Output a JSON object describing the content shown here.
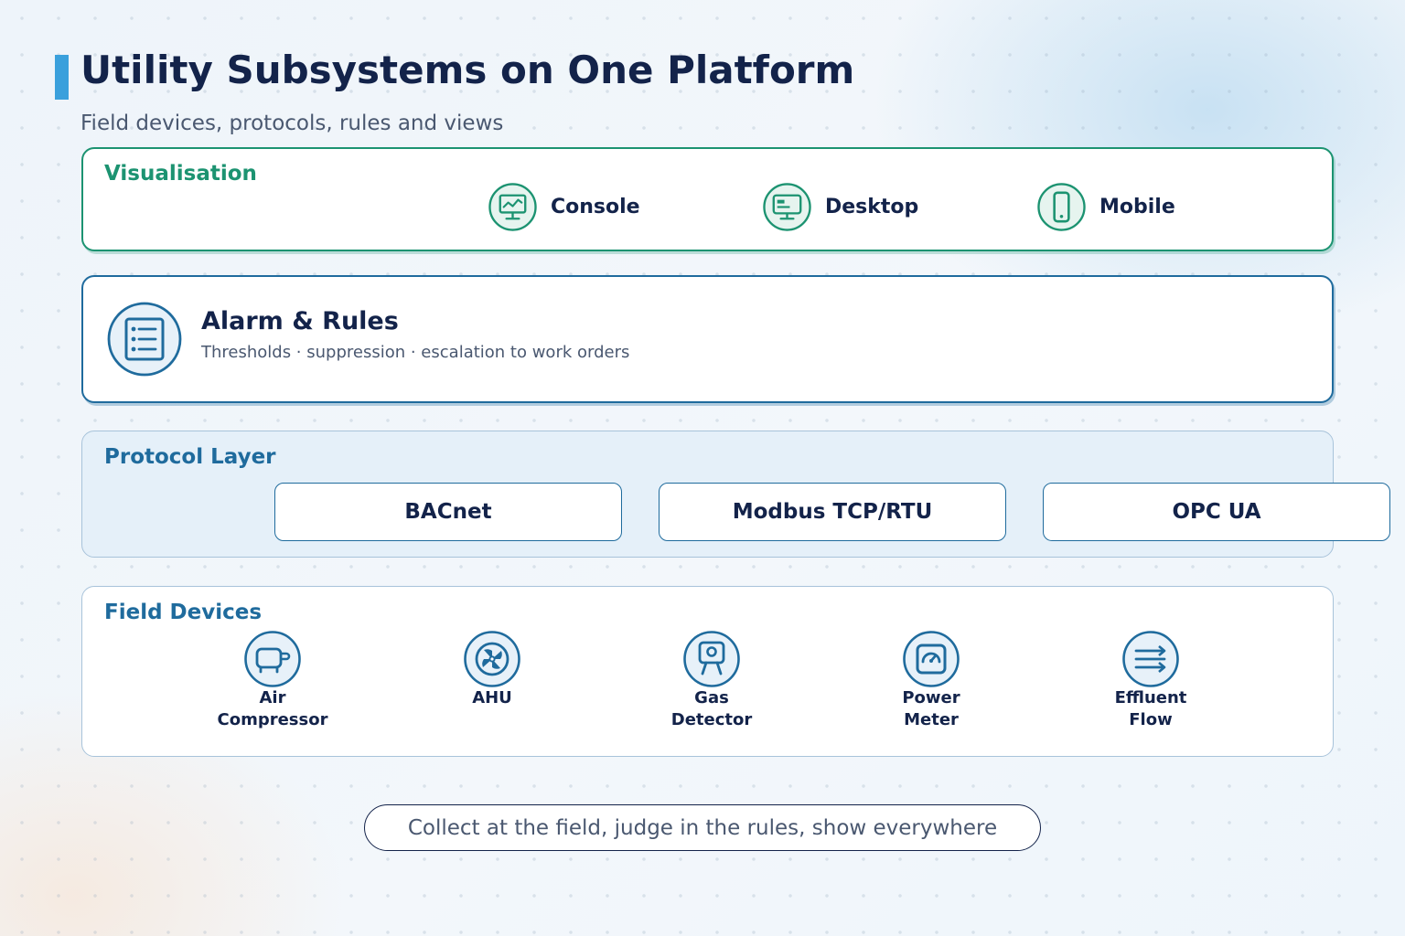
{
  "header": {
    "title": "Utility Subsystems on One Platform",
    "subtitle": "Field devices, protocols, rules and views"
  },
  "visualisation": {
    "label": "Visualisation",
    "items": [
      {
        "label": "Console",
        "icon": "console-monitor-icon"
      },
      {
        "label": "Desktop",
        "icon": "desktop-icon"
      },
      {
        "label": "Mobile",
        "icon": "mobile-phone-icon"
      }
    ]
  },
  "alarm": {
    "title": "Alarm & Rules",
    "description": "Thresholds · suppression · escalation to work orders",
    "icon": "checklist-icon"
  },
  "protocol": {
    "label": "Protocol Layer",
    "items": [
      "BACnet",
      "Modbus TCP/RTU",
      "OPC UA"
    ]
  },
  "field": {
    "label": "Field Devices",
    "devices": [
      {
        "line1": "Air",
        "line2": "Compressor",
        "icon": "air-compressor-icon"
      },
      {
        "line1": "AHU",
        "line2": "",
        "icon": "fan-icon"
      },
      {
        "line1": "Gas",
        "line2": "Detector",
        "icon": "gas-detector-icon"
      },
      {
        "line1": "Power",
        "line2": "Meter",
        "icon": "power-meter-icon"
      },
      {
        "line1": "Effluent",
        "line2": "Flow",
        "icon": "flow-icon"
      }
    ]
  },
  "footer": {
    "tagline": "Collect at the field, judge in the rules, show everywhere"
  },
  "colors": {
    "green": "#1c9371",
    "blue": "#1f6b9d",
    "navy": "#13234a",
    "accent": "#3aa0dc"
  }
}
